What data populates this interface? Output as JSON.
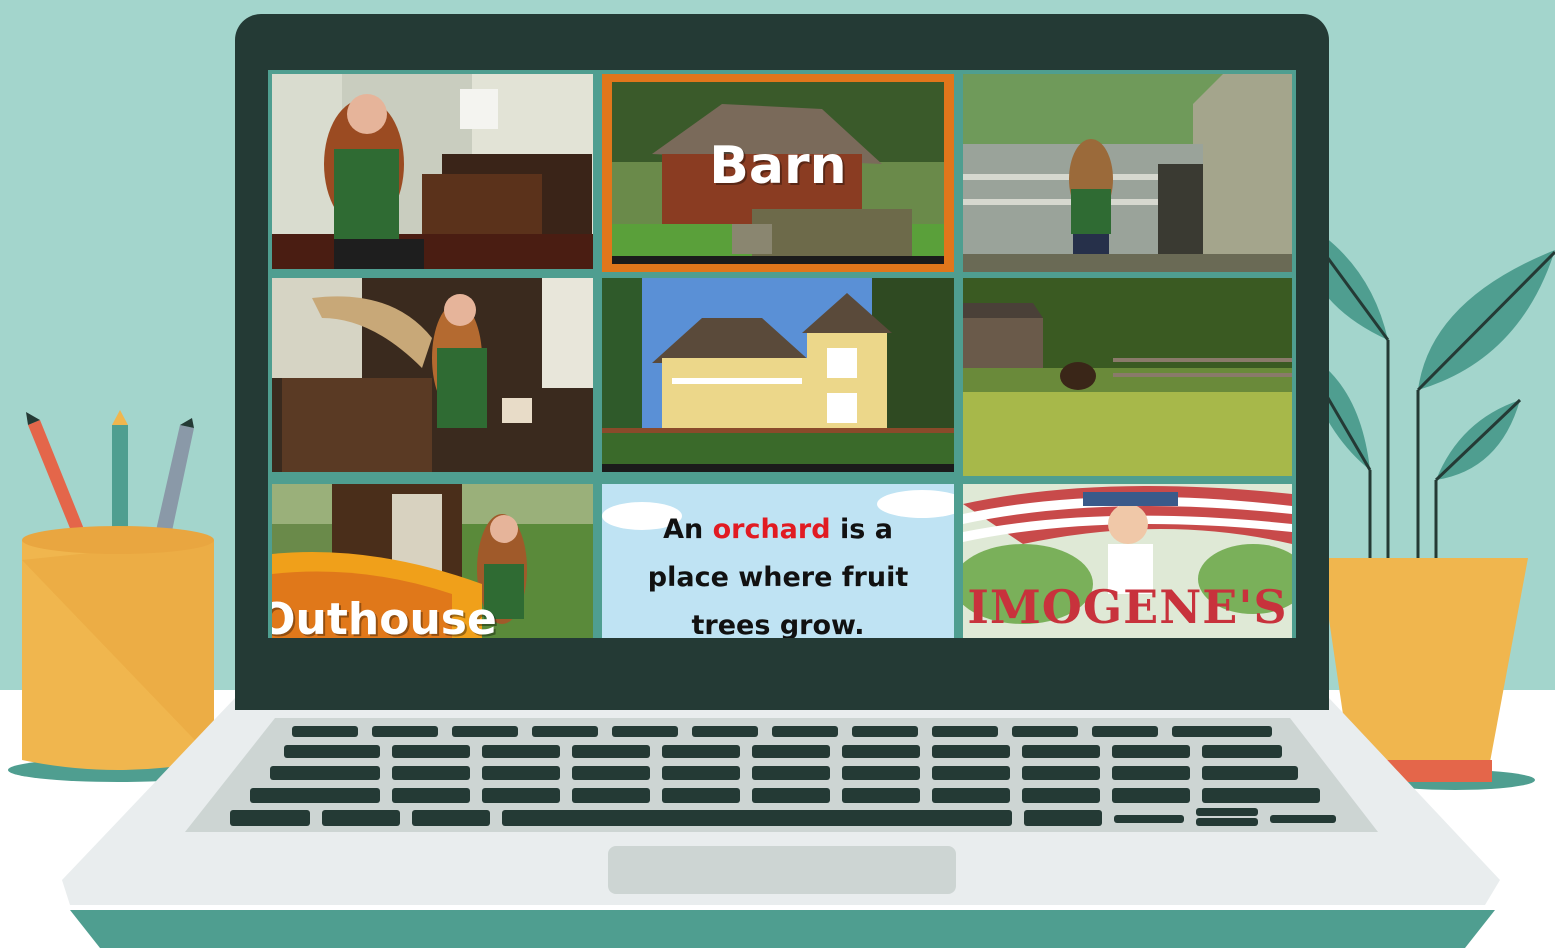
{
  "scene": {
    "background_color": "#a3d5cc",
    "desk_color": "#ffffff",
    "bezel_color": "#243a35",
    "accent_color": "#4f9e90"
  },
  "video_grid": {
    "tiles": [
      {
        "subject": "girl holding bucket beside wooden commode",
        "caption": ""
      },
      {
        "subject": "old red barn with rusty truck",
        "caption": "Barn"
      },
      {
        "subject": "girl standing by weathered shed",
        "caption": ""
      },
      {
        "subject": "girl at spinning wheel in farmhouse",
        "caption": ""
      },
      {
        "subject": "yellow two-story farmhouse",
        "caption": ""
      },
      {
        "subject": "horse in sunny pasture",
        "caption": ""
      },
      {
        "subject": "girl standing in doorway of outhouse",
        "caption": "Outhouse"
      },
      {
        "subject": "orchard definition slide",
        "caption_parts": [
          "An ",
          "orchard",
          " is a",
          "place where fruit",
          "trees grow."
        ]
      },
      {
        "subject": "Imogene's book cover with flag",
        "caption": "IMOGENE'S"
      }
    ]
  }
}
